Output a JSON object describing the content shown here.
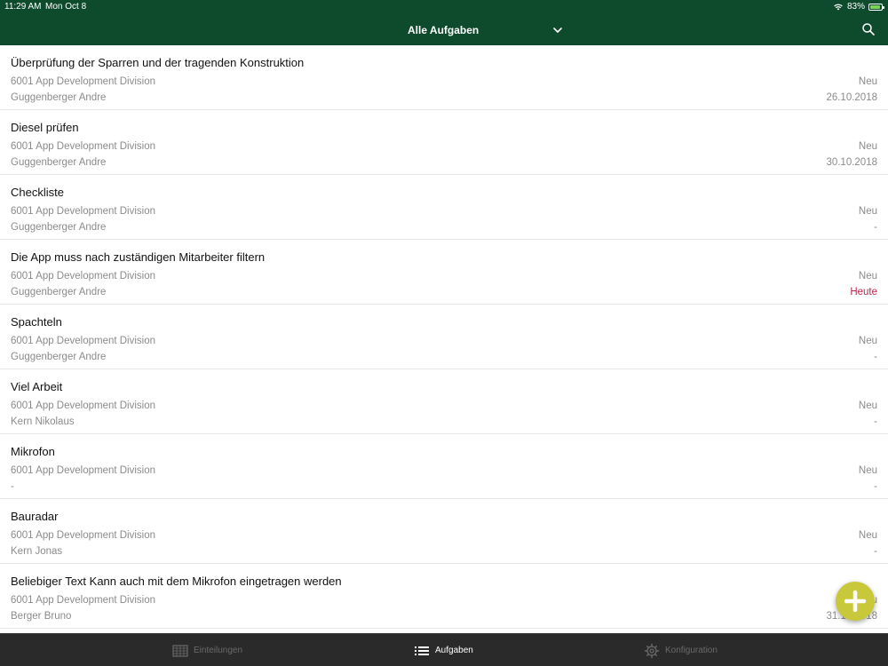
{
  "status_bar": {
    "time": "11:29 AM",
    "date": "Mon Oct 8",
    "battery": "83%"
  },
  "header": {
    "title": "Alle Aufgaben"
  },
  "tasks": [
    {
      "title": "Überprüfung der Sparren und der tragenden Konstruktion",
      "org": "6001 App Development Division",
      "person": "Guggenberger Andre",
      "status": "Neu",
      "due": "26.10.2018"
    },
    {
      "title": "Diesel prüfen",
      "org": "6001 App Development Division",
      "person": "Guggenberger Andre",
      "status": "Neu",
      "due": "30.10.2018"
    },
    {
      "title": "Checkliste",
      "org": "6001 App Development Division",
      "person": "Guggenberger Andre",
      "status": "Neu",
      "due": "-"
    },
    {
      "title": "Die App muss nach zuständigen Mitarbeiter filtern",
      "org": "6001 App Development Division",
      "person": "Guggenberger Andre",
      "status": "Neu",
      "due": "Heute"
    },
    {
      "title": "Spachteln",
      "org": "6001 App Development Division",
      "person": "Guggenberger Andre",
      "status": "Neu",
      "due": "-"
    },
    {
      "title": "Viel Arbeit",
      "org": "6001 App Development Division",
      "person": "Kern Nikolaus",
      "status": "Neu",
      "due": "-"
    },
    {
      "title": "Mikrofon",
      "org": "6001 App Development Division",
      "person": "-",
      "status": "Neu",
      "due": "-"
    },
    {
      "title": "Bauradar",
      "org": "6001 App Development Division",
      "person": "Kern Jonas",
      "status": "Neu",
      "due": "-"
    },
    {
      "title": "Beliebiger Text Kann auch mit dem Mikrofon eingetragen werden",
      "org": "6001 App Development Division",
      "person": "Berger Bruno",
      "status": "Neu",
      "due": "31.10.2018"
    }
  ],
  "tabbar": {
    "tabs": [
      {
        "label": "Einteilungen",
        "icon": "grid-icon"
      },
      {
        "label": "Aufgaben",
        "icon": "list-icon"
      },
      {
        "label": "Konfiguration",
        "icon": "gear-icon"
      }
    ]
  },
  "colors": {
    "header_bg": "#0e4a2c",
    "fab_bg": "#c8c83a",
    "today_red": "#b52a4a",
    "tabbar_bg": "#2a2a2a"
  }
}
